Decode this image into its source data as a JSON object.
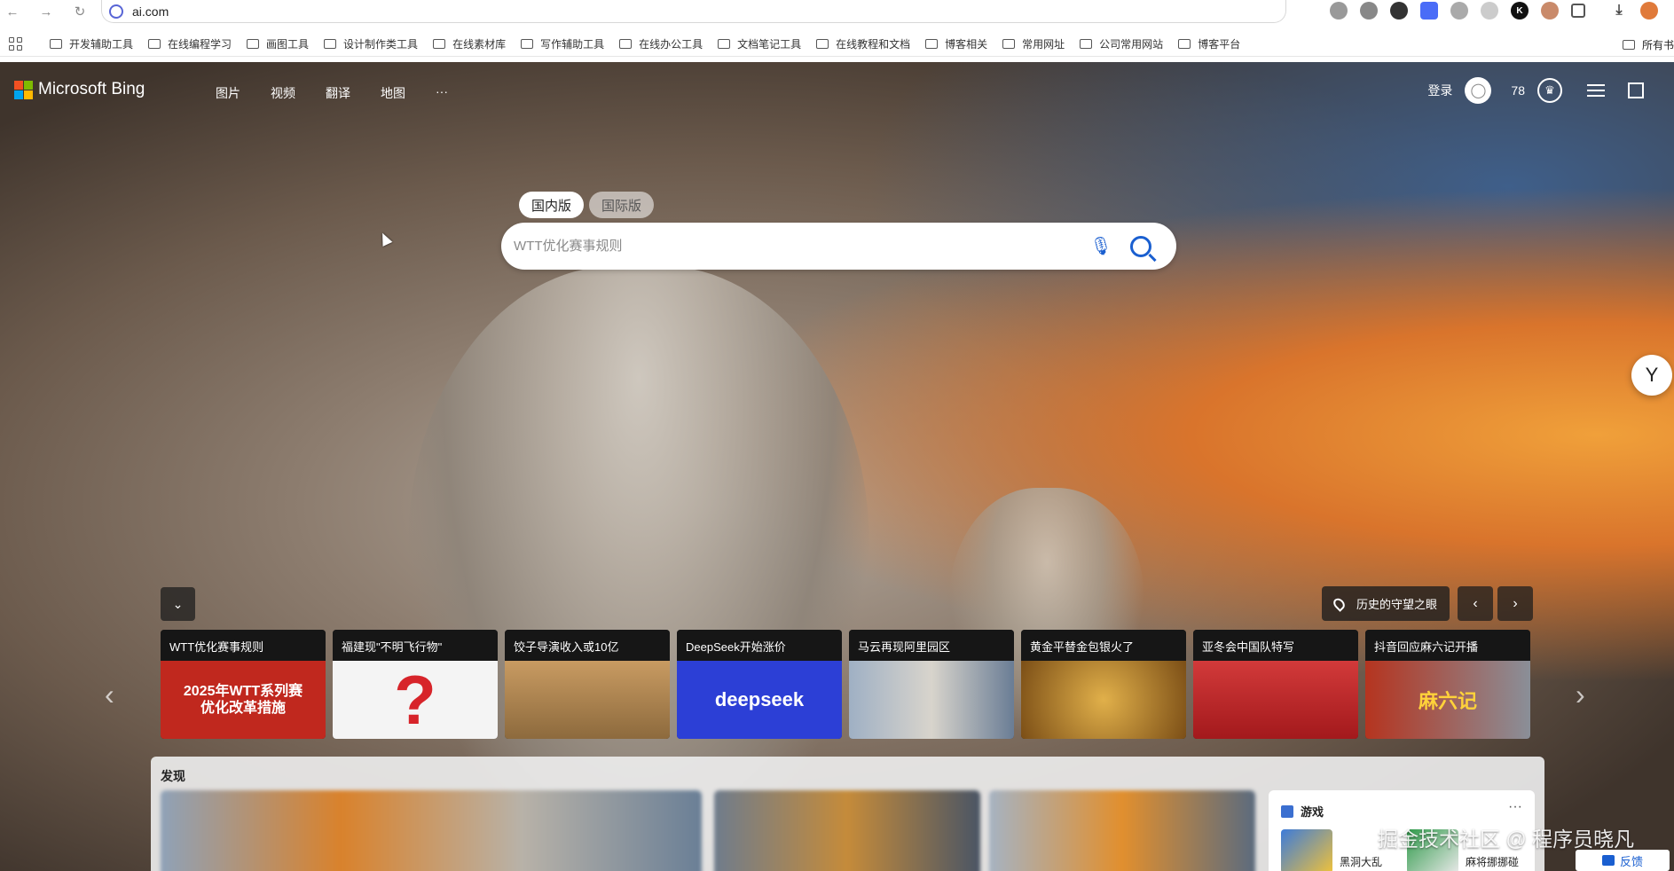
{
  "browser": {
    "url": "ai.com",
    "bookmarks": [
      "开发辅助工具",
      "在线编程学习",
      "画图工具",
      "设计制作类工具",
      "在线素材库",
      "写作辅助工具",
      "在线办公工具",
      "文档笔记工具",
      "在线教程和文档",
      "博客相关",
      "常用网址",
      "公司常用网站",
      "博客平台"
    ],
    "bookmarks_right": "所有书"
  },
  "bing": {
    "logo": "Microsoft Bing",
    "nav": [
      "图片",
      "视频",
      "翻译",
      "地图",
      "···"
    ],
    "login": "登录",
    "points": "78"
  },
  "search": {
    "tabs": [
      "国内版",
      "国际版"
    ],
    "placeholder": "WTT优化赛事规则"
  },
  "carousel": {
    "location_label": "历史的守望之眼",
    "cards": [
      {
        "title": "WTT优化赛事规则",
        "img_text": "2025年WTT系列赛\n优化改革措施",
        "bg": "#c0281e"
      },
      {
        "title": "福建现\"不明飞行物\"",
        "img_text": "",
        "bg": "#f4f4f4"
      },
      {
        "title": "饺子导演收入或10亿",
        "img_text": "",
        "bg": "#b88d57"
      },
      {
        "title": "DeepSeek开始涨价",
        "img_text": "deepseek",
        "bg": "#2c3fd6"
      },
      {
        "title": "马云再现阿里园区",
        "img_text": "",
        "bg": "#c8d0d8"
      },
      {
        "title": "黄金平替金包银火了",
        "img_text": "",
        "bg": "#a66f24"
      },
      {
        "title": "亚冬会中国队特写",
        "img_text": "",
        "bg": "#c8262a"
      },
      {
        "title": "抖音回应麻六记开播",
        "img_text": "麻六记",
        "bg": "#b5341f"
      }
    ]
  },
  "discover": {
    "label": "发现",
    "game": {
      "title": "游戏",
      "more": "···",
      "items": [
        "黑洞大乱",
        "麻将挪挪碰"
      ]
    }
  },
  "watermark": "掘金技术社区 @ 程序员晓凡",
  "feedback": "反馈"
}
